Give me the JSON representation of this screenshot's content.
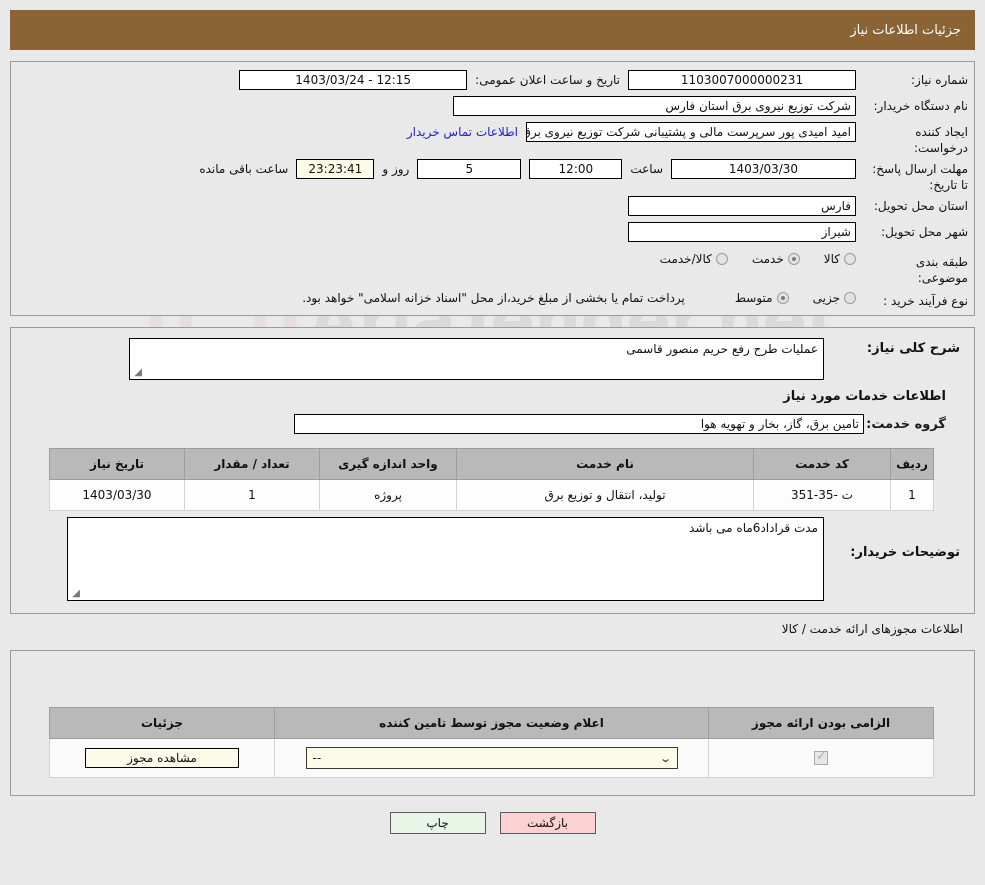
{
  "header": {
    "title": "جزئیات اطلاعات نیاز"
  },
  "watermark": {
    "text": "AriaTender.net"
  },
  "info": {
    "need_number_label": "شماره نیاز:",
    "need_number_value": "1103007000000231",
    "announce_label": "تاریخ و ساعت اعلان عمومی:",
    "announce_value": "12:15 - 1403/03/24",
    "buyer_org_label": "نام دستگاه خریدار:",
    "buyer_org_value": "شرکت توزیع نیروی برق استان فارس",
    "creator_label": "ایجاد کننده درخواست:",
    "creator_value": "امید امیدی پور سرپرست مالی و پشتیبانی  شرکت توزیع نیروی برق استان فارس",
    "contact_link": "اطلاعات تماس خریدار",
    "deadline_label": "مهلت ارسال پاسخ: تا تاریخ:",
    "deadline_date": "1403/03/30",
    "deadline_time_label": "ساعت",
    "deadline_time": "12:00",
    "deadline_days": "5",
    "deadline_days_label": "روز و",
    "deadline_countdown": "23:23:41",
    "deadline_remaining_label": "ساعت باقی مانده",
    "province_label": "استان محل تحویل:",
    "province_value": "فارس",
    "city_label": "شهر محل تحویل:",
    "city_value": "شیراز",
    "category_label": "طبقه بندی موضوعی:",
    "category_options": [
      {
        "label": "کالا",
        "selected": false
      },
      {
        "label": "خدمت",
        "selected": true
      },
      {
        "label": "کالا/خدمت",
        "selected": false
      }
    ],
    "process_label": "نوع فرآیند خرید :",
    "process_options": [
      {
        "label": "جزیی",
        "selected": false
      },
      {
        "label": "متوسط",
        "selected": true
      }
    ],
    "process_note": "پرداخت تمام یا بخشی از مبلغ خرید،از محل \"اسناد خزانه اسلامی\" خواهد بود."
  },
  "details": {
    "overview_label": "شرح کلی نیاز:",
    "overview_value": "عملیات طرح رفع حریم منصور قاسمی",
    "services_heading": "اطلاعات خدمات مورد نیاز",
    "service_group_label": "گروه خدمت:",
    "service_group_value": "تامین برق، گاز، بخار و تهویه هوا",
    "table": {
      "columns": [
        "ردیف",
        "کد خدمت",
        "نام خدمت",
        "واحد اندازه گیری",
        "تعداد / مقدار",
        "تاریخ نیاز"
      ],
      "rows": [
        {
          "row": "1",
          "code": "ت -35-351",
          "name": "تولید، انتقال و توزیع برق",
          "unit": "پروژه",
          "qty": "1",
          "date": "1403/03/30"
        }
      ]
    },
    "notes_label": "توضیحات خریدار:",
    "notes_value": "مدت قراداد6ماه می باشد"
  },
  "licenses": {
    "heading": "اطلاعات مجوزهای ارائه خدمت / کالا",
    "columns": [
      "الزامی بودن ارائه مجوز",
      "اعلام وضعیت مجوز توسط تامین کننده",
      "جزئیات"
    ],
    "rows": [
      {
        "required": true,
        "status_value": "--",
        "details_button": "مشاهده مجوز"
      }
    ]
  },
  "footer": {
    "print_label": "چاپ",
    "back_label": "بازگشت"
  }
}
